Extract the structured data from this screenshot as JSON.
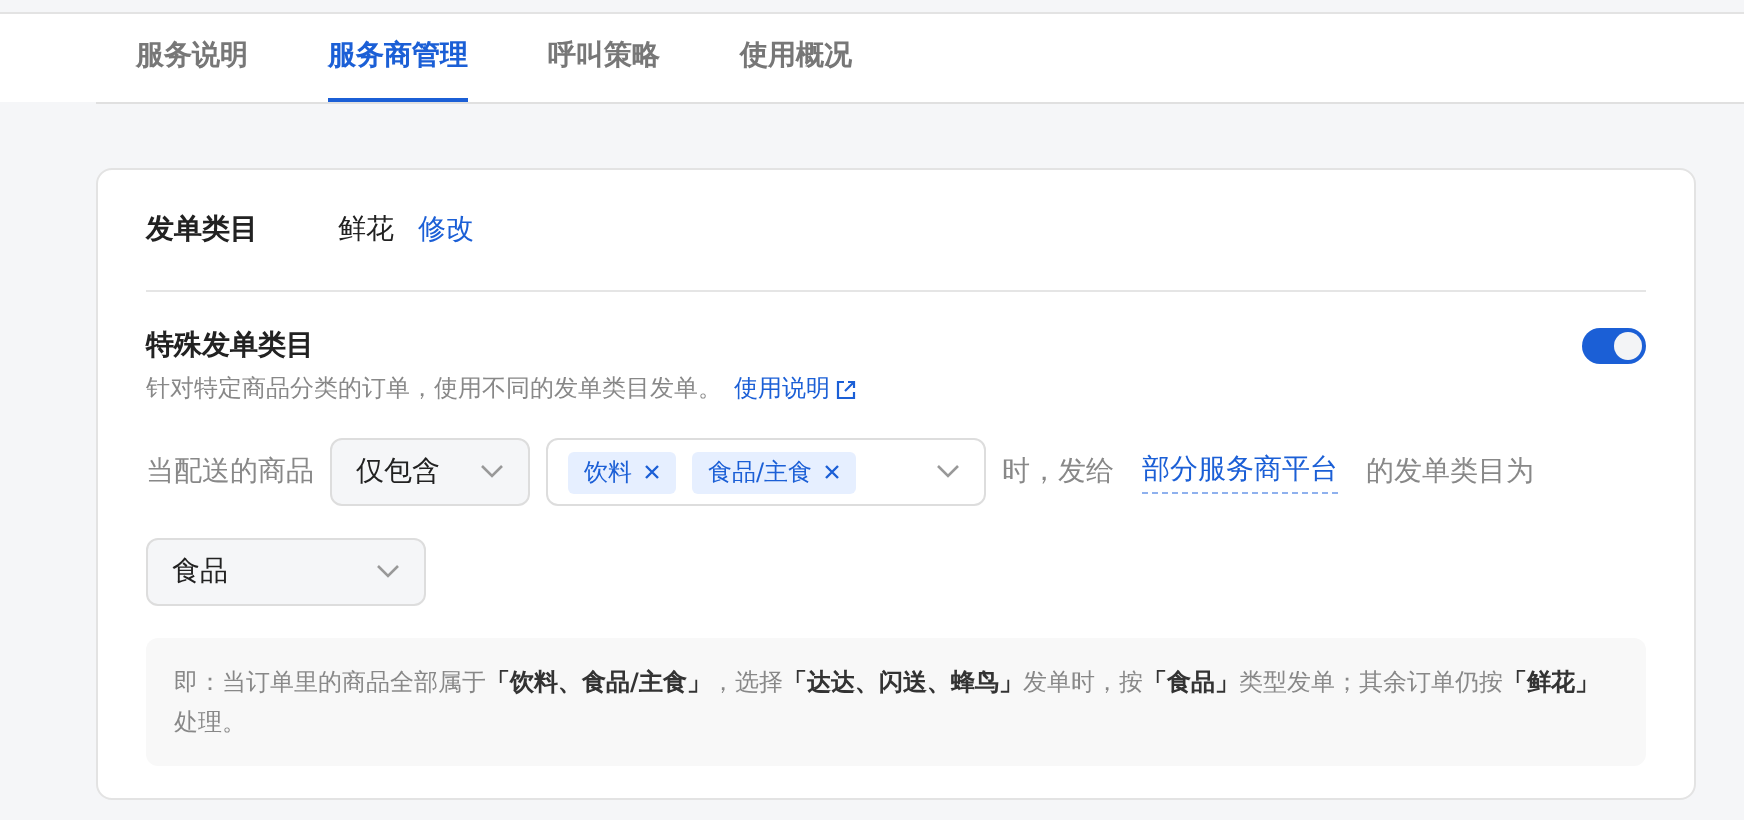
{
  "tabs": [
    {
      "label": "服务说明",
      "selected": false
    },
    {
      "label": "服务商管理",
      "selected": true
    },
    {
      "label": "呼叫策略",
      "selected": false
    },
    {
      "label": "使用概况",
      "selected": false
    }
  ],
  "category": {
    "label": "发单类目",
    "value": "鲜花",
    "edit_link": "修改"
  },
  "special": {
    "title": "特殊发单类目",
    "description": "针对特定商品分类的订单，使用不同的发单类目发单。",
    "help_link": "使用说明",
    "on": true
  },
  "rule": {
    "prefix": "当配送的商品",
    "mode": "仅包含",
    "tags": [
      "饮料",
      "食品/主食"
    ],
    "middle": "时，发给",
    "platform_link": "部分服务商平台",
    "suffix": "的发单类目为",
    "target": "食品"
  },
  "note": "即：当订单里的商品全部属于**「饮料、食品/主食」**，选择**「达达、闪送、蜂鸟」**发单时，按**「食品」**类型发单；其余订单仍按**「鲜花」**处理。"
}
